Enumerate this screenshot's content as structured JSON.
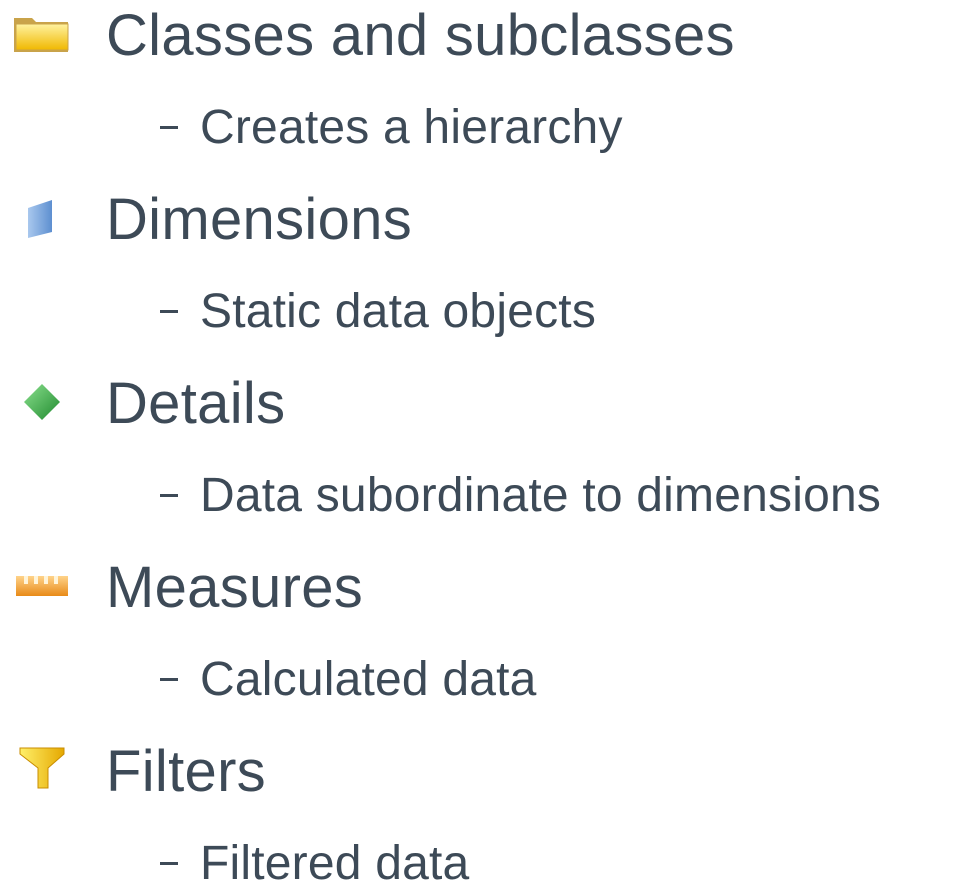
{
  "items": [
    {
      "icon": "folder-icon",
      "title": "Classes and subclasses",
      "subtitle": "Creates a hierarchy"
    },
    {
      "icon": "dimension-icon",
      "title": "Dimensions",
      "subtitle": "Static data objects"
    },
    {
      "icon": "detail-diamond-icon",
      "title": "Details",
      "subtitle": "Data subordinate to dimensions"
    },
    {
      "icon": "measure-ruler-icon",
      "title": "Measures",
      "subtitle": "Calculated data"
    },
    {
      "icon": "filter-funnel-icon",
      "title": "Filters",
      "subtitle": "Filtered data"
    }
  ],
  "colors": {
    "text": "#3d4a57",
    "folder": "#f5c400",
    "dimension": "#7fa9dc",
    "detail": "#3aa845",
    "measure": "#f0a030",
    "filter": "#f2c500"
  }
}
